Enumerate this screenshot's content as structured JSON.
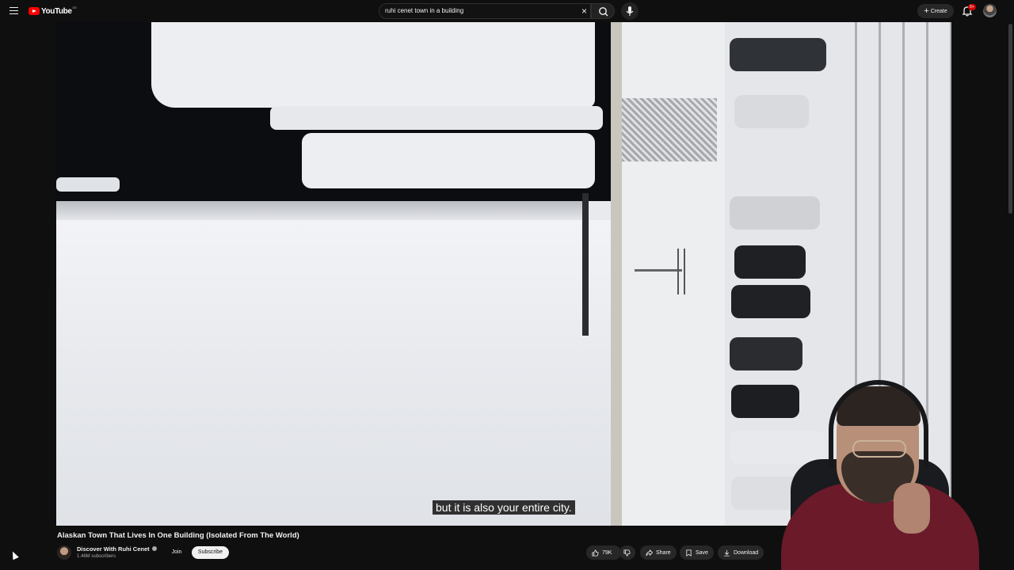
{
  "header": {
    "logo_text": "YouTube",
    "logo_country": "DE",
    "search_value": "ruhi cenet town in a building",
    "create_label": "Create",
    "notification_count": "9+"
  },
  "player": {
    "caption": "but it is also your entire city."
  },
  "video": {
    "title": "Alaskan Town That Lives In One Building (Isolated From The World)",
    "channel_name": "Discover With Ruhi Cenet",
    "subscribers": "1.46M subscribers",
    "join_label": "Join",
    "subscribe_label": "Subscribe",
    "like_count": "79K",
    "share_label": "Share",
    "save_label": "Save",
    "download_label": "Download"
  },
  "colors": {
    "background": "#0f0f0f",
    "brand_red": "#ff0000",
    "pill_bg": "#272727"
  },
  "icons": [
    "menu-icon",
    "youtube-logo-icon",
    "close-icon",
    "search-icon",
    "mic-icon",
    "plus-icon",
    "bell-icon",
    "like-icon",
    "dislike-icon",
    "share-icon",
    "save-icon",
    "download-icon",
    "verified-icon"
  ]
}
